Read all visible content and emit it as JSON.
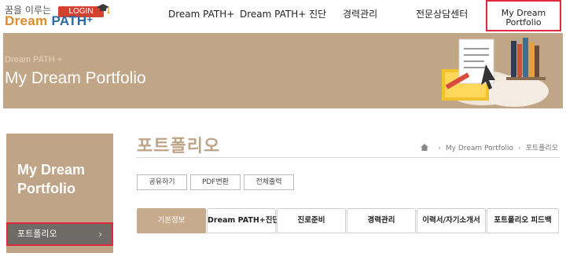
{
  "header": {
    "logo_top": "꿈을 이루는",
    "logo_dream": "Dream",
    "logo_path": "PATH",
    "logo_plus": "+",
    "login_label": "LOGIN",
    "nav": [
      {
        "label": "Dream PATH+"
      },
      {
        "label": "Dream PATH+ 진단"
      },
      {
        "label": "경력관리"
      },
      {
        "label": "전문상담센터"
      },
      {
        "label": "My Dream\nPortfolio"
      }
    ]
  },
  "banner": {
    "subtitle": "Dream PATH +",
    "title": "My Dream Portfolio"
  },
  "sidebar": {
    "title": "My Dream Portfolio",
    "items": [
      {
        "label": "포트폴리오",
        "chevron": "›"
      }
    ]
  },
  "main": {
    "title": "포트폴리오",
    "breadcrumb": [
      "My Dream Portfolio",
      "포트폴리오"
    ],
    "buttons": [
      {
        "label": "공유하기"
      },
      {
        "label": "PDF변환"
      },
      {
        "label": "전체출력"
      }
    ],
    "tabs": [
      {
        "label": "기본정보"
      },
      {
        "label": "Dream PATH+진단"
      },
      {
        "label": "진로준비"
      },
      {
        "label": "경력관리"
      },
      {
        "label": "이력서/자기소개서"
      },
      {
        "label": "포트폴리오 피드백"
      }
    ]
  },
  "colors": {
    "accent_brown": "#c0a587",
    "highlight_red": "#e02a3c",
    "sidebar_item_bg": "#6f6a66"
  }
}
